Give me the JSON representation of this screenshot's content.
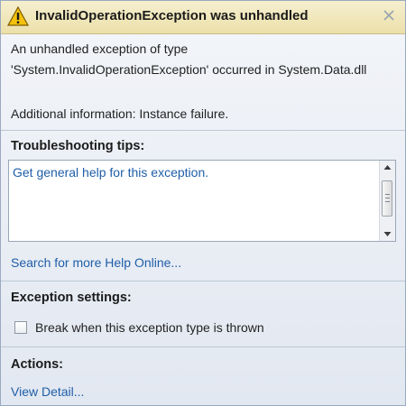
{
  "dialog": {
    "title": "InvalidOperationException was unhandled",
    "message_line1": "An unhandled exception of type",
    "message_line2": "'System.InvalidOperationException' occurred in System.Data.dll",
    "additional_info": "Additional information: Instance failure."
  },
  "troubleshooting": {
    "heading": "Troubleshooting tips:",
    "tips": [
      "Get general help for this exception."
    ]
  },
  "search_link": "Search for more Help Online...",
  "exception_settings": {
    "heading": "Exception settings:",
    "checkbox_label": "Break when this exception type is thrown",
    "checked": false
  },
  "actions": {
    "heading": "Actions:",
    "view_detail": "View Detail..."
  },
  "icons": {
    "title": "warning-icon",
    "close": "close-icon"
  }
}
